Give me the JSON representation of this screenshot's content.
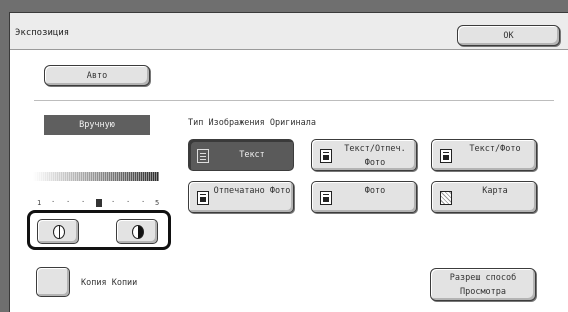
{
  "title": "Экспозиция",
  "ok_label": "OK",
  "auto_label": "Авто",
  "manual_label": "Вручную",
  "original_type_label": "Тип Изображения Оригинала",
  "original_types": [
    {
      "label": "Текст",
      "icon": "text-doc-icon",
      "selected": true
    },
    {
      "label": "Текст/Отпеч. Фото",
      "icon": "text-printed-photo-icon",
      "selected": false
    },
    {
      "label": "Текст/Фото",
      "icon": "text-photo-icon",
      "selected": false
    },
    {
      "label": "Отпечатано Фото",
      "icon": "printed-photo-icon",
      "selected": false
    },
    {
      "label": "Фото",
      "icon": "photo-icon",
      "selected": false
    },
    {
      "label": "Карта",
      "icon": "map-icon",
      "selected": false
    }
  ],
  "exposure_scale": {
    "min": "1",
    "max": "5",
    "current": 3
  },
  "copy_of_copy_label": "Копия Копии",
  "preview_label": "Разреш способ Просмотра"
}
